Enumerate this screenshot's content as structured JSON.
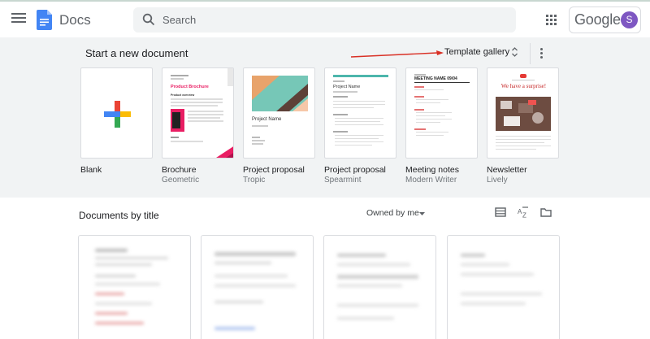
{
  "app": {
    "title": "Docs"
  },
  "search": {
    "placeholder": "Search"
  },
  "account": {
    "brand": "Google",
    "avatar_letter": "S"
  },
  "templates": {
    "section_title": "Start a new document",
    "gallery_label": "Template gallery",
    "items": [
      {
        "name": "Blank",
        "sub": ""
      },
      {
        "name": "Brochure",
        "sub": "Geometric",
        "thumb_title": "Product Brochure",
        "thumb_sub": "Product overview"
      },
      {
        "name": "Project proposal",
        "sub": "Tropic",
        "thumb_title": "Project Name"
      },
      {
        "name": "Project proposal",
        "sub": "Spearmint",
        "thumb_title": "Project Name"
      },
      {
        "name": "Meeting notes",
        "sub": "Modern Writer",
        "thumb_title": "MEETING NAME 09/04"
      },
      {
        "name": "Newsletter",
        "sub": "Lively",
        "thumb_title": "We have a surprise!"
      }
    ]
  },
  "documents": {
    "heading": "Documents by title",
    "owner_filter": "Owned by me"
  },
  "colors": {
    "accent_blue": "#4285f4",
    "annotation_arrow": "#d93025",
    "avatar": "#7e57c2",
    "brochure_pink": "#e91e63",
    "tropic_teal": "#76c7b7",
    "tropic_orange": "#e8a36b"
  }
}
